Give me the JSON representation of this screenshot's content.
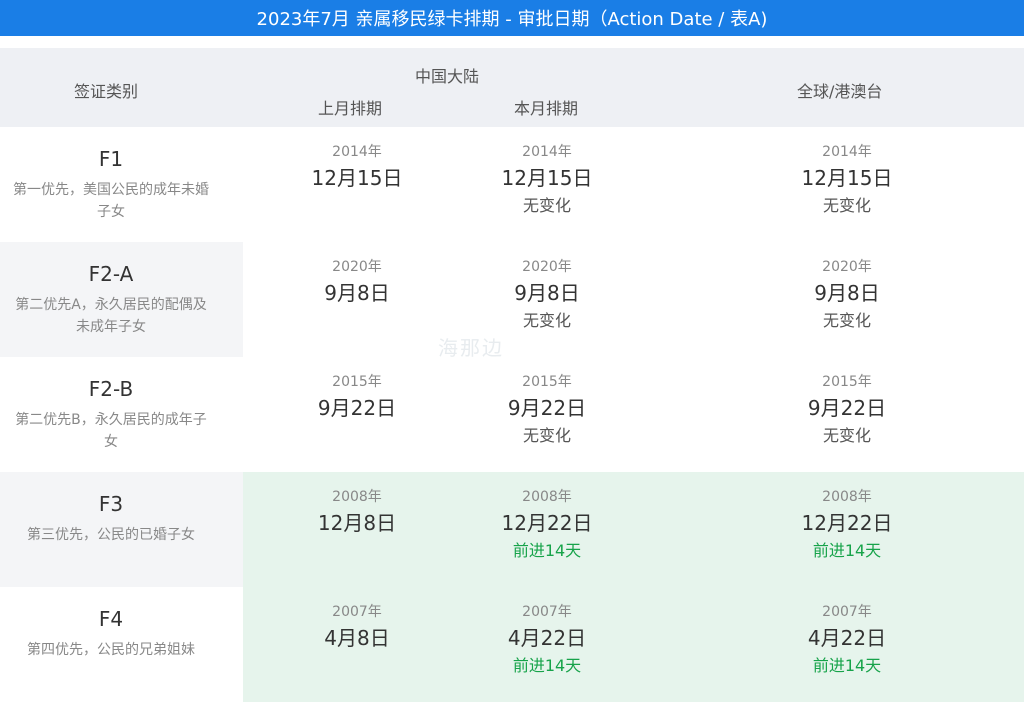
{
  "title": "2023年7月 亲属移民绿卡排期 - 审批日期（Action Date / 表A)",
  "header": {
    "category": "签证类别",
    "china_mainland": "中国大陆",
    "last_month": "上月排期",
    "this_month": "本月排期",
    "global": "全球/港澳台"
  },
  "rows": [
    {
      "code": "F1",
      "desc_line1": "第一优先，美国公民的成年未婚",
      "desc_line2": "子女",
      "last": {
        "year": "2014年",
        "date": "12月15日"
      },
      "this": {
        "year": "2014年",
        "date": "12月15日",
        "change": "无变化"
      },
      "global": {
        "year": "2014年",
        "date": "12月15日",
        "change": "无变化"
      }
    },
    {
      "code": "F2-A",
      "desc_line1": "第二优先A，永久居民的配偶及",
      "desc_line2": "未成年子女",
      "last": {
        "year": "2020年",
        "date": "9月8日"
      },
      "this": {
        "year": "2020年",
        "date": "9月8日",
        "change": "无变化"
      },
      "global": {
        "year": "2020年",
        "date": "9月8日",
        "change": "无变化"
      }
    },
    {
      "code": "F2-B",
      "desc_line1": "第二优先B，永久居民的成年子",
      "desc_line2": "女",
      "last": {
        "year": "2015年",
        "date": "9月22日"
      },
      "this": {
        "year": "2015年",
        "date": "9月22日",
        "change": "无变化"
      },
      "global": {
        "year": "2015年",
        "date": "9月22日",
        "change": "无变化"
      }
    },
    {
      "code": "F3",
      "desc_line1": "第三优先，公民的已婚子女",
      "desc_line2": "",
      "last": {
        "year": "2008年",
        "date": "12月8日"
      },
      "this": {
        "year": "2008年",
        "date": "12月22日",
        "change": "前进14天"
      },
      "global": {
        "year": "2008年",
        "date": "12月22日",
        "change": "前进14天"
      }
    },
    {
      "code": "F4",
      "desc_line1": "第四优先，公民的兄弟姐妹",
      "desc_line2": "",
      "last": {
        "year": "2007年",
        "date": "4月8日"
      },
      "this": {
        "year": "2007年",
        "date": "4月22日",
        "change": "前进14天"
      },
      "global": {
        "year": "2007年",
        "date": "4月22日",
        "change": "前进14天"
      }
    }
  ],
  "watermark": "海那边",
  "colors": {
    "title_bg": "#1a7ee6",
    "header_bg": "#eef0f4",
    "advance_text": "#17a34a",
    "advance_row_bg": "#e6f4ec"
  }
}
